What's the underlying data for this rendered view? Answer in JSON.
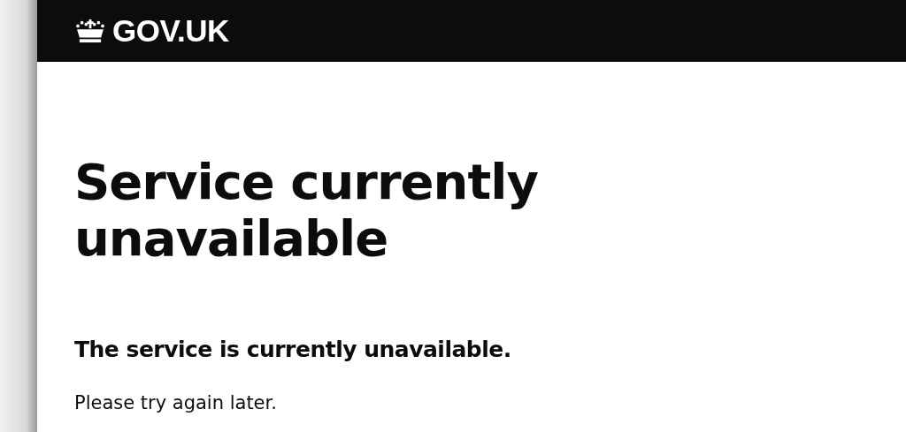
{
  "header": {
    "logo_text": "GOV.UK"
  },
  "main": {
    "heading": "Service currently unavailable",
    "subheading": "The service is currently unavailable.",
    "body": "Please try again later."
  }
}
